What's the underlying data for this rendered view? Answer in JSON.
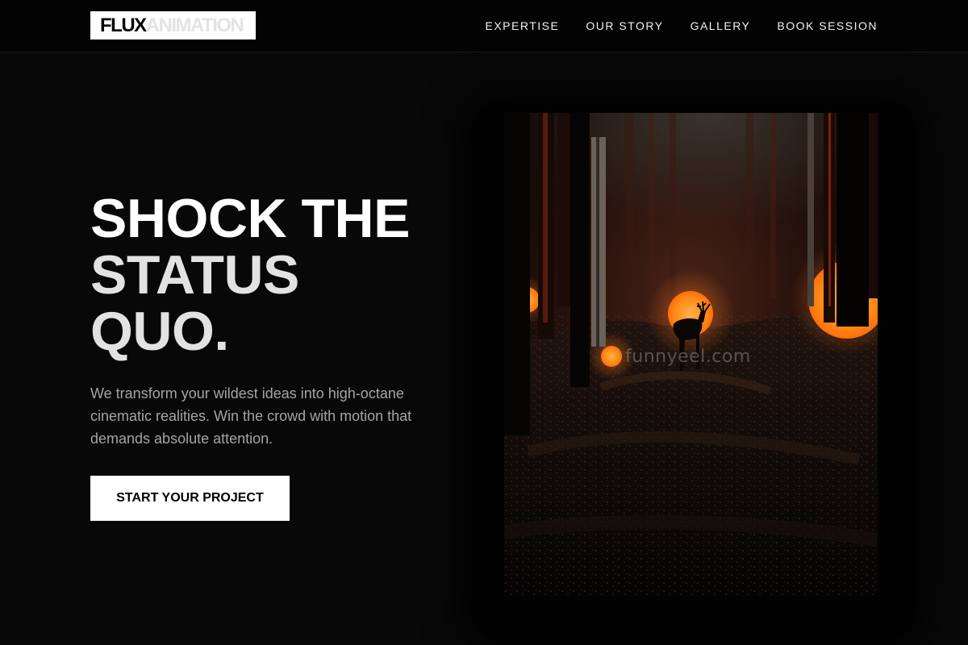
{
  "header": {
    "logo_part1": "FLUX",
    "logo_part2": "ANIMATION",
    "nav": [
      {
        "label": "EXPERTISE"
      },
      {
        "label": "OUR STORY"
      },
      {
        "label": "GALLERY"
      },
      {
        "label": "BOOK SESSION"
      }
    ]
  },
  "hero": {
    "headline_line1": "SHOCK THE",
    "headline_line2": "STATUS",
    "headline_line3": "QUO.",
    "description": "We transform your wildest ideas into high-octane cinematic realities. Win the crowd with motion that demands absolute attention.",
    "cta_label": "START YOUR PROJECT"
  },
  "media": {
    "watermark": "funnyeel.com",
    "icon": "forest-deer-scene-image"
  },
  "colors": {
    "background": "#080808",
    "header_bg": "#030303",
    "accent_orange": "#ff8a1a",
    "text_primary": "#ffffff",
    "text_muted": "#a4a4a4"
  }
}
